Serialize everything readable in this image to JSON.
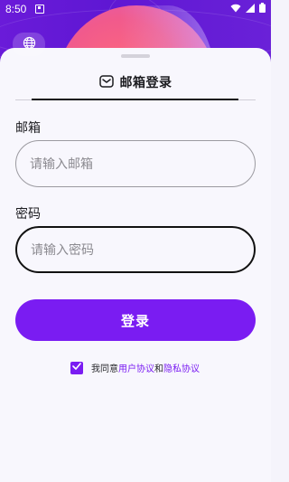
{
  "status_bar": {
    "time": "8:50"
  },
  "sheet": {
    "tab_title": "邮箱登录"
  },
  "form": {
    "email_label": "邮箱",
    "email_placeholder": "请输入邮箱",
    "password_label": "密码",
    "password_placeholder": "请输入密码",
    "login_button": "登录"
  },
  "agreement": {
    "prefix": "我同意",
    "user_agreement": "用户协议",
    "and": "和",
    "privacy_agreement": "隐私协议",
    "checked": true
  },
  "icons": {
    "globe": "globe-icon",
    "mail": "mail-icon",
    "wifi": "wifi-icon",
    "signal": "signal-icon",
    "battery": "battery-icon",
    "check": "check-icon"
  },
  "colors": {
    "accent": "#7a1cf2",
    "hero": "#6a1bd9",
    "sun": "#ff6a7c"
  }
}
